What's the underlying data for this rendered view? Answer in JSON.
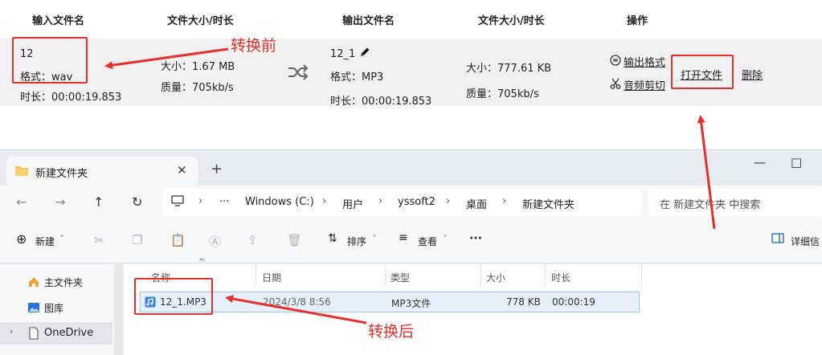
{
  "converter": {
    "headers": {
      "input_name": "输入文件名",
      "size_duration": "文件大小/时长",
      "output_name": "输出文件名",
      "size_duration_2": "文件大小/时长",
      "actions": "操作"
    },
    "row": {
      "input_file": "12",
      "input_format": "格式：wav",
      "input_duration": "时长：00:00:19.853",
      "input_size": "大小：1.67 MB",
      "input_quality": "质量：705kb/s",
      "output_file": "12_1",
      "output_format": "格式：MP3",
      "output_duration": "时长：00:00:19.853",
      "output_size": "大小：777.61 KB",
      "output_quality": "质量：705kb/s",
      "output_format_btn": "输出格式",
      "audio_cut_btn": "音频剪切",
      "open_file_btn": "打开文件",
      "delete_btn": "删除"
    },
    "annotations": {
      "before": "转换前",
      "after": "转换后"
    }
  },
  "explorer": {
    "tab_title": "新建文件夹",
    "new_tab": "+",
    "window_controls": [
      "—",
      "□"
    ],
    "nav": {
      "back": "←",
      "forward": "→",
      "up": "↑",
      "refresh": "↻"
    },
    "breadcrumb": [
      "Windows (C:)",
      "用户",
      "yssoft2",
      "桌面",
      "新建文件夹"
    ],
    "breadcrumb_more": "···",
    "search_placeholder": "在 新建文件夹 中搜索",
    "toolbar": {
      "new": "新建",
      "sort": "排序",
      "view": "查看",
      "more": "···",
      "details": "详细信"
    },
    "sidebar": [
      {
        "label": "主文件夹",
        "icon": "home-icon"
      },
      {
        "label": "图库",
        "icon": "gallery-icon"
      },
      {
        "label": "OneDrive",
        "icon": "file-icon"
      }
    ],
    "columns": [
      "名称",
      "日期",
      "类型",
      "大小",
      "时长"
    ],
    "files": [
      {
        "name": "12_1.MP3",
        "date": "2024/3/8 8:56",
        "type": "MP3文件",
        "size": "778 KB",
        "duration": "00:00:19"
      }
    ]
  },
  "colors": {
    "annotation_red": "#e5302b",
    "selected_row": "#e5f0fb"
  }
}
